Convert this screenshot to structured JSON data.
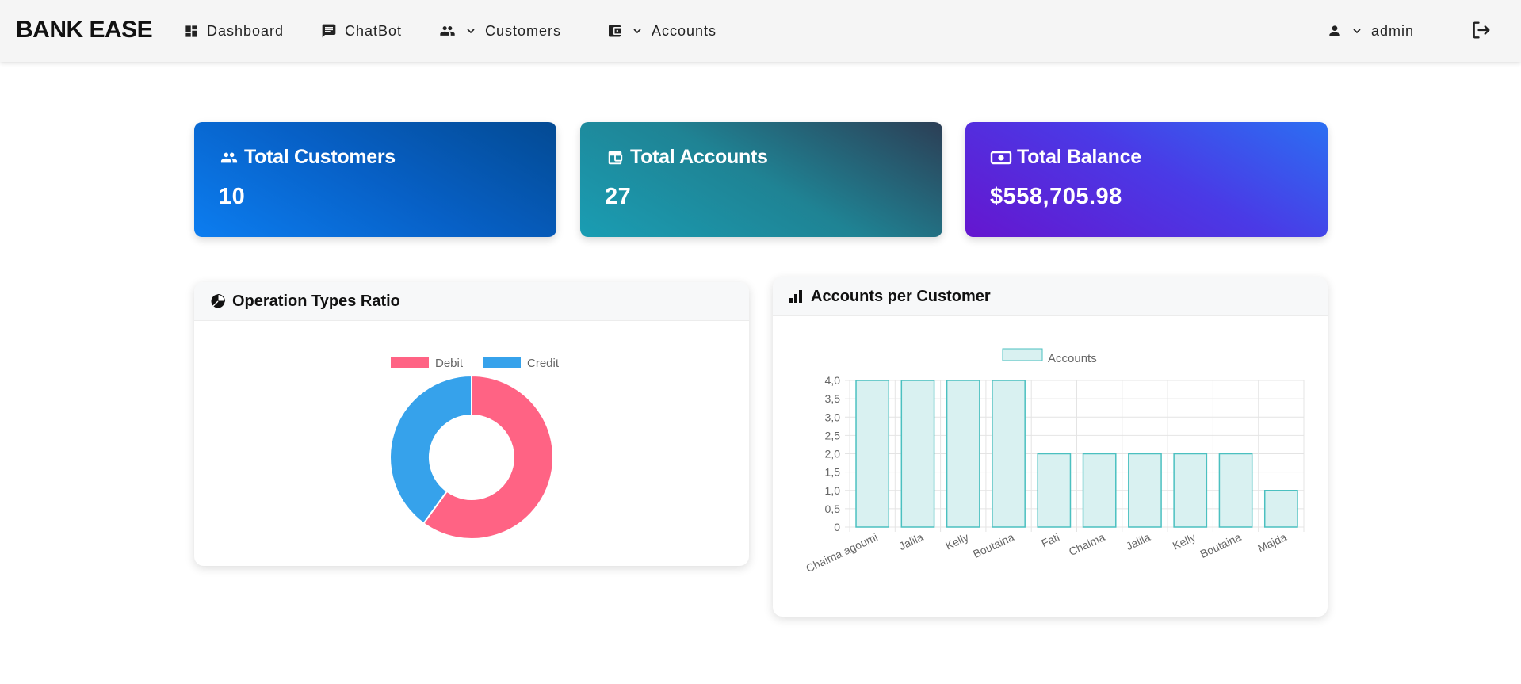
{
  "app": {
    "brand": "BANK EASE"
  },
  "nav": {
    "dashboard": "Dashboard",
    "chatbot": "ChatBot",
    "customers": "Customers",
    "accounts": "Accounts",
    "user": "admin"
  },
  "stats": {
    "customers": {
      "label": "Total Customers",
      "value": "10"
    },
    "accounts": {
      "label": "Total Accounts",
      "value": "27"
    },
    "balance": {
      "label": "Total Balance",
      "value": "$558,705.98"
    }
  },
  "panels": {
    "ops": {
      "title": "Operation Types Ratio"
    },
    "apc": {
      "title": "Accounts per Customer"
    }
  },
  "colors": {
    "debit": "#ff6384",
    "credit": "#36a2eb",
    "bar_fill": "#d9f1f1",
    "bar_stroke": "#4bc0c0"
  },
  "chart_data": [
    {
      "type": "pie",
      "variant": "doughnut",
      "legend_position": "top",
      "labels": [
        "Debit",
        "Credit"
      ],
      "values": [
        60,
        40
      ],
      "colors": [
        "#ff6384",
        "#36a2eb"
      ]
    },
    {
      "type": "bar",
      "legend_position": "top",
      "grid": true,
      "series": [
        {
          "name": "Accounts",
          "values": [
            4,
            4,
            4,
            4,
            2,
            2,
            2,
            2,
            2,
            1
          ]
        }
      ],
      "categories": [
        "Chaima agoumi",
        "Jalila",
        "Kelly",
        "Boutaina",
        "Fati",
        "Chaima",
        "Jalila",
        "Kelly",
        "Boutaina",
        "Majda"
      ],
      "ylim": [
        0,
        4
      ],
      "yticks": [
        "0",
        "0,5",
        "1,0",
        "1,5",
        "2,0",
        "2,5",
        "3,0",
        "3,5",
        "4,0"
      ]
    }
  ]
}
